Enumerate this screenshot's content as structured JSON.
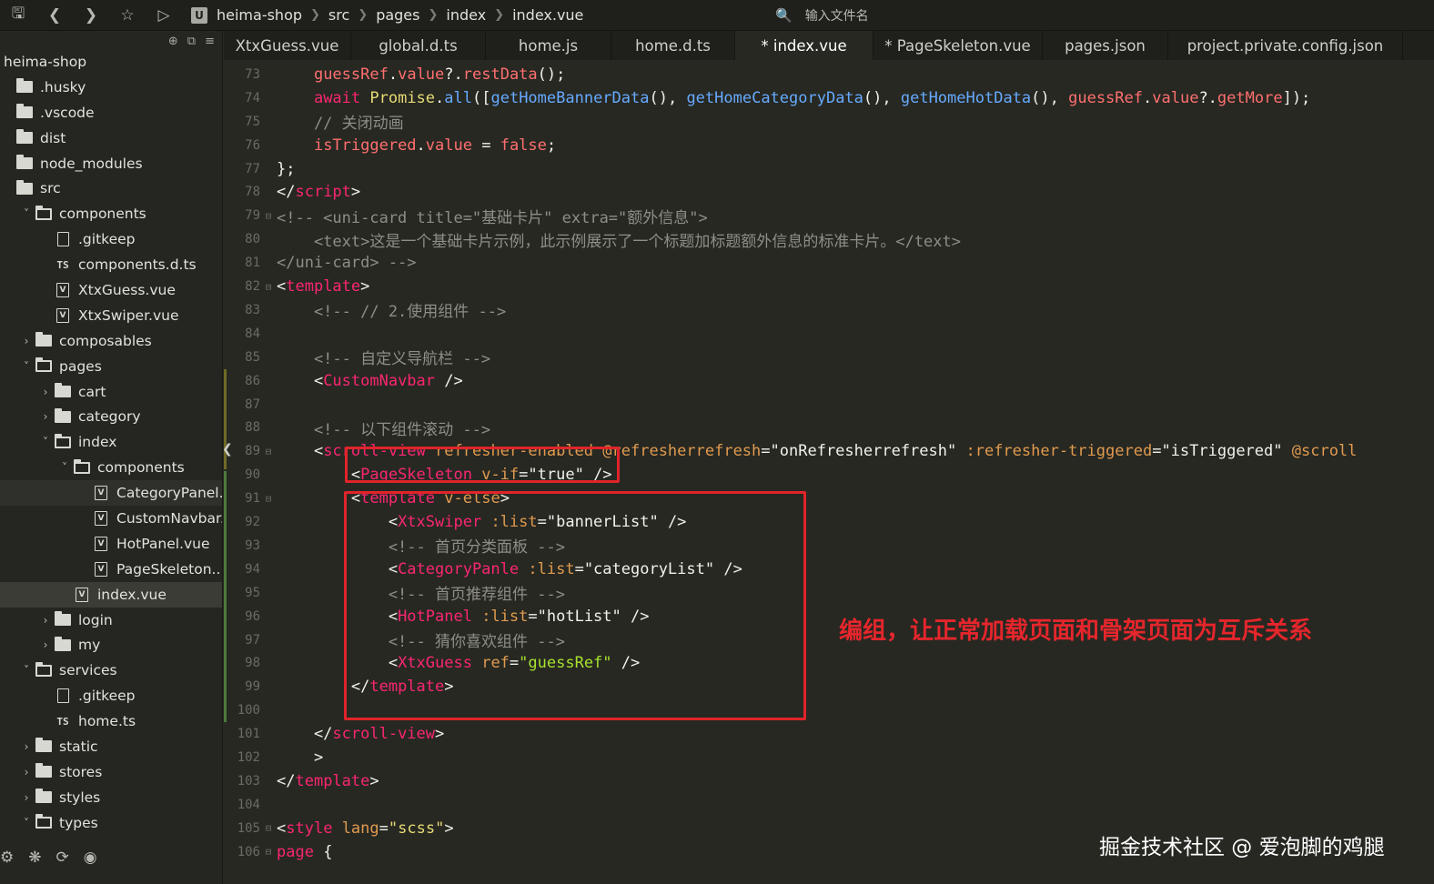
{
  "toolbar": {
    "breadcrumb": [
      "heima-shop",
      "src",
      "pages",
      "index",
      "index.vue"
    ],
    "file_search_placeholder": "输入文件名"
  },
  "sidebar": {
    "project": "heima-shop",
    "items": [
      {
        "label": ".husky",
        "kind": "folder",
        "depth": 0,
        "chevron": ""
      },
      {
        "label": ".vscode",
        "kind": "folder",
        "depth": 0,
        "chevron": ""
      },
      {
        "label": "dist",
        "kind": "folder",
        "depth": 0,
        "chevron": ""
      },
      {
        "label": "node_modules",
        "kind": "folder",
        "depth": 0,
        "chevron": ""
      },
      {
        "label": "src",
        "kind": "folder",
        "depth": 0,
        "chevron": ""
      },
      {
        "label": "components",
        "kind": "folder-open",
        "depth": 1,
        "chevron": "v"
      },
      {
        "label": ".gitkeep",
        "kind": "file",
        "depth": 2,
        "chevron": ""
      },
      {
        "label": "components.d.ts",
        "kind": "ts",
        "depth": 2,
        "chevron": ""
      },
      {
        "label": "XtxGuess.vue",
        "kind": "vue",
        "depth": 2,
        "chevron": ""
      },
      {
        "label": "XtxSwiper.vue",
        "kind": "vue",
        "depth": 2,
        "chevron": ""
      },
      {
        "label": "composables",
        "kind": "folder",
        "depth": 1,
        "chevron": ">"
      },
      {
        "label": "pages",
        "kind": "folder-open",
        "depth": 1,
        "chevron": "v"
      },
      {
        "label": "cart",
        "kind": "folder",
        "depth": 2,
        "chevron": ">"
      },
      {
        "label": "category",
        "kind": "folder",
        "depth": 2,
        "chevron": ">"
      },
      {
        "label": "index",
        "kind": "folder-open",
        "depth": 2,
        "chevron": "v"
      },
      {
        "label": "components",
        "kind": "folder-open",
        "depth": 3,
        "chevron": "v"
      },
      {
        "label": "CategoryPanel...",
        "kind": "vue",
        "depth": 4,
        "chevron": "",
        "state": "dim"
      },
      {
        "label": "CustomNavbar...",
        "kind": "vue",
        "depth": 4,
        "chevron": ""
      },
      {
        "label": "HotPanel.vue",
        "kind": "vue",
        "depth": 4,
        "chevron": ""
      },
      {
        "label": "PageSkeleton....",
        "kind": "vue",
        "depth": 4,
        "chevron": ""
      },
      {
        "label": "index.vue",
        "kind": "vue",
        "depth": 3,
        "chevron": "",
        "state": "selected"
      },
      {
        "label": "login",
        "kind": "folder",
        "depth": 2,
        "chevron": ">"
      },
      {
        "label": "my",
        "kind": "folder",
        "depth": 2,
        "chevron": ">"
      },
      {
        "label": "services",
        "kind": "folder-open",
        "depth": 1,
        "chevron": "v"
      },
      {
        "label": ".gitkeep",
        "kind": "file",
        "depth": 2,
        "chevron": ""
      },
      {
        "label": "home.ts",
        "kind": "ts",
        "depth": 2,
        "chevron": ""
      },
      {
        "label": "static",
        "kind": "folder",
        "depth": 1,
        "chevron": ">"
      },
      {
        "label": "stores",
        "kind": "folder",
        "depth": 1,
        "chevron": ">"
      },
      {
        "label": "styles",
        "kind": "folder",
        "depth": 1,
        "chevron": ">"
      },
      {
        "label": "types",
        "kind": "folder-open",
        "depth": 1,
        "chevron": "v"
      }
    ]
  },
  "tabs": [
    {
      "label": "XtxGuess.vue",
      "active": false
    },
    {
      "label": "global.d.ts",
      "active": false
    },
    {
      "label": "home.js",
      "active": false
    },
    {
      "label": "home.d.ts",
      "active": false
    },
    {
      "label": "* index.vue",
      "active": true
    },
    {
      "label": "* PageSkeleton.vue",
      "active": false
    },
    {
      "label": "pages.json",
      "active": false
    },
    {
      "label": "project.private.config.json",
      "active": false
    }
  ],
  "code_lines": [
    {
      "n": "73",
      "fold": "",
      "tokens": [
        [
          "    ",
          "plain"
        ],
        [
          "guessRef",
          "var"
        ],
        [
          ".",
          "plain"
        ],
        [
          "value",
          "var"
        ],
        [
          "?.",
          "plain"
        ],
        [
          "restData",
          "var"
        ],
        [
          "();",
          "plain"
        ]
      ]
    },
    {
      "n": "74",
      "fold": "",
      "tokens": [
        [
          "    ",
          "plain"
        ],
        [
          "await ",
          "kw"
        ],
        [
          "Promise",
          "str"
        ],
        [
          ".",
          "plain"
        ],
        [
          "all",
          "fn"
        ],
        [
          "([",
          "plain"
        ],
        [
          "getHomeBannerData",
          "fn"
        ],
        [
          "(), ",
          "plain"
        ],
        [
          "getHomeCategoryData",
          "fn"
        ],
        [
          "(), ",
          "plain"
        ],
        [
          "getHomeHotData",
          "fn"
        ],
        [
          "(), ",
          "plain"
        ],
        [
          "guessRef",
          "var"
        ],
        [
          ".",
          "plain"
        ],
        [
          "value",
          "var"
        ],
        [
          "?.",
          "plain"
        ],
        [
          "getMore",
          "var"
        ],
        [
          "]);",
          "plain"
        ]
      ]
    },
    {
      "n": "75",
      "fold": "",
      "tokens": [
        [
          "    // 关闭动画",
          "cmt"
        ]
      ]
    },
    {
      "n": "76",
      "fold": "",
      "tokens": [
        [
          "    ",
          "plain"
        ],
        [
          "isTriggered",
          "var"
        ],
        [
          ".",
          "plain"
        ],
        [
          "value",
          "var"
        ],
        [
          " = ",
          "plain"
        ],
        [
          "false",
          "bool"
        ],
        [
          ";",
          "plain"
        ]
      ]
    },
    {
      "n": "77",
      "fold": "",
      "tokens": [
        [
          "};",
          "plain"
        ]
      ]
    },
    {
      "n": "78",
      "fold": "",
      "tokens": [
        [
          "</",
          "plain"
        ],
        [
          "script",
          "tag"
        ],
        [
          ">",
          "plain"
        ]
      ]
    },
    {
      "n": "79",
      "fold": "-",
      "tokens": [
        [
          "<!-- <uni-card title=\"基础卡片\" extra=\"额外信息\">",
          "cmt"
        ]
      ]
    },
    {
      "n": "80",
      "fold": "",
      "tokens": [
        [
          "    <text>这是一个基础卡片示例，此示例展示了一个标题加标题额外信息的标准卡片。</text>",
          "cmt"
        ]
      ]
    },
    {
      "n": "81",
      "fold": "",
      "tokens": [
        [
          "</uni-card> -->",
          "cmt"
        ]
      ]
    },
    {
      "n": "82",
      "fold": "-",
      "tokens": [
        [
          "<",
          "plain"
        ],
        [
          "template",
          "tag"
        ],
        [
          ">",
          "plain"
        ]
      ]
    },
    {
      "n": "83",
      "fold": "",
      "tokens": [
        [
          "    <!-- // 2.使用组件 -->",
          "cmt"
        ]
      ]
    },
    {
      "n": "84",
      "fold": "",
      "tokens": [
        [
          "",
          "plain"
        ]
      ]
    },
    {
      "n": "85",
      "fold": "",
      "tokens": [
        [
          "    <!-- 自定义导航栏 -->",
          "cmt"
        ]
      ]
    },
    {
      "n": "86",
      "fold": "",
      "tokens": [
        [
          "    <",
          "plain"
        ],
        [
          "CustomNavbar",
          "tag"
        ],
        [
          " />",
          "plain"
        ]
      ]
    },
    {
      "n": "87",
      "fold": "",
      "tokens": [
        [
          "",
          "plain"
        ]
      ]
    },
    {
      "n": "88",
      "fold": "",
      "tokens": [
        [
          "    <!-- 以下组件滚动 -->",
          "cmt"
        ]
      ]
    },
    {
      "n": "89",
      "fold": "-",
      "tokens": [
        [
          "    <",
          "plain"
        ],
        [
          "scroll-view",
          "tag"
        ],
        [
          " ",
          "plain"
        ],
        [
          "refresher-enabled",
          "attr"
        ],
        [
          " ",
          "plain"
        ],
        [
          "@refresherrefresh",
          "attr"
        ],
        [
          "=",
          "plain"
        ],
        [
          "\"onRefresherrefresh\"",
          "plain"
        ],
        [
          " ",
          "plain"
        ],
        [
          ":refresher-triggered",
          "attr"
        ],
        [
          "=",
          "plain"
        ],
        [
          "\"isTriggered\"",
          "plain"
        ],
        [
          " ",
          "plain"
        ],
        [
          "@scroll",
          "attr"
        ]
      ]
    },
    {
      "n": "90",
      "fold": "",
      "tokens": [
        [
          "        <",
          "plain"
        ],
        [
          "PageSkeleton",
          "tag"
        ],
        [
          " ",
          "plain"
        ],
        [
          "v-if",
          "attr"
        ],
        [
          "=",
          "plain"
        ],
        [
          "\"true\"",
          "plain"
        ],
        [
          " />",
          "plain"
        ]
      ]
    },
    {
      "n": "91",
      "fold": "-",
      "tokens": [
        [
          "        <",
          "plain"
        ],
        [
          "template",
          "tag"
        ],
        [
          " ",
          "plain"
        ],
        [
          "v-else",
          "attr"
        ],
        [
          ">",
          "plain"
        ]
      ]
    },
    {
      "n": "92",
      "fold": "",
      "tokens": [
        [
          "            <",
          "plain"
        ],
        [
          "XtxSwiper",
          "tag"
        ],
        [
          " ",
          "plain"
        ],
        [
          ":list",
          "attr"
        ],
        [
          "=",
          "plain"
        ],
        [
          "\"bannerList\"",
          "plain"
        ],
        [
          " />",
          "plain"
        ]
      ]
    },
    {
      "n": "93",
      "fold": "",
      "tokens": [
        [
          "            <!-- 首页分类面板 -->",
          "cmt"
        ]
      ]
    },
    {
      "n": "94",
      "fold": "",
      "tokens": [
        [
          "            <",
          "plain"
        ],
        [
          "CategoryPanle",
          "tag"
        ],
        [
          " ",
          "plain"
        ],
        [
          ":list",
          "attr"
        ],
        [
          "=",
          "plain"
        ],
        [
          "\"categoryList\"",
          "plain"
        ],
        [
          " />",
          "plain"
        ]
      ]
    },
    {
      "n": "95",
      "fold": "",
      "tokens": [
        [
          "            <!-- 首页推荐组件 -->",
          "cmt"
        ]
      ]
    },
    {
      "n": "96",
      "fold": "",
      "tokens": [
        [
          "            <",
          "plain"
        ],
        [
          "HotPanel",
          "tag"
        ],
        [
          " ",
          "plain"
        ],
        [
          ":list",
          "attr"
        ],
        [
          "=",
          "plain"
        ],
        [
          "\"hotList\"",
          "plain"
        ],
        [
          " />",
          "plain"
        ]
      ]
    },
    {
      "n": "97",
      "fold": "",
      "tokens": [
        [
          "            <!-- 猜你喜欢组件 -->",
          "cmt"
        ]
      ]
    },
    {
      "n": "98",
      "fold": "",
      "tokens": [
        [
          "            <",
          "plain"
        ],
        [
          "XtxGuess",
          "tag"
        ],
        [
          " ",
          "plain"
        ],
        [
          "ref",
          "attr"
        ],
        [
          "=",
          "plain"
        ],
        [
          "\"guessRef\"",
          "green"
        ],
        [
          " />",
          "plain"
        ]
      ]
    },
    {
      "n": "99",
      "fold": "",
      "tokens": [
        [
          "        </",
          "plain"
        ],
        [
          "template",
          "tag"
        ],
        [
          ">",
          "plain"
        ]
      ]
    },
    {
      "n": "100",
      "fold": "",
      "tokens": [
        [
          "",
          "plain"
        ]
      ]
    },
    {
      "n": "101",
      "fold": "",
      "tokens": [
        [
          "    </",
          "plain"
        ],
        [
          "scroll-view",
          "tag"
        ],
        [
          ">",
          "plain"
        ]
      ]
    },
    {
      "n": "102",
      "fold": "",
      "tokens": [
        [
          "    >",
          "plain"
        ]
      ]
    },
    {
      "n": "103",
      "fold": "",
      "tokens": [
        [
          "</",
          "plain"
        ],
        [
          "template",
          "tag"
        ],
        [
          ">",
          "plain"
        ]
      ]
    },
    {
      "n": "104",
      "fold": "",
      "tokens": [
        [
          "",
          "plain"
        ]
      ]
    },
    {
      "n": "105",
      "fold": "-",
      "tokens": [
        [
          "<",
          "plain"
        ],
        [
          "style",
          "tag"
        ],
        [
          " ",
          "plain"
        ],
        [
          "lang",
          "attr"
        ],
        [
          "=",
          "plain"
        ],
        [
          "\"scss\"",
          "str"
        ],
        [
          ">",
          "plain"
        ]
      ]
    },
    {
      "n": "106",
      "fold": "-",
      "tokens": [
        [
          "page",
          "tag"
        ],
        [
          " {",
          "plain"
        ]
      ]
    }
  ],
  "annotation": "编组，让正常加载页面和骨架页面为互斥关系",
  "watermark": "掘金技术社区 @ 爱泡脚的鸡腿",
  "colors": {
    "editor_bg": "#272822",
    "annotation_red": "#e0242a",
    "tag": "#f92672",
    "attr": "#e09a4f",
    "function": "#66aaff",
    "comment": "#8e8e86"
  }
}
